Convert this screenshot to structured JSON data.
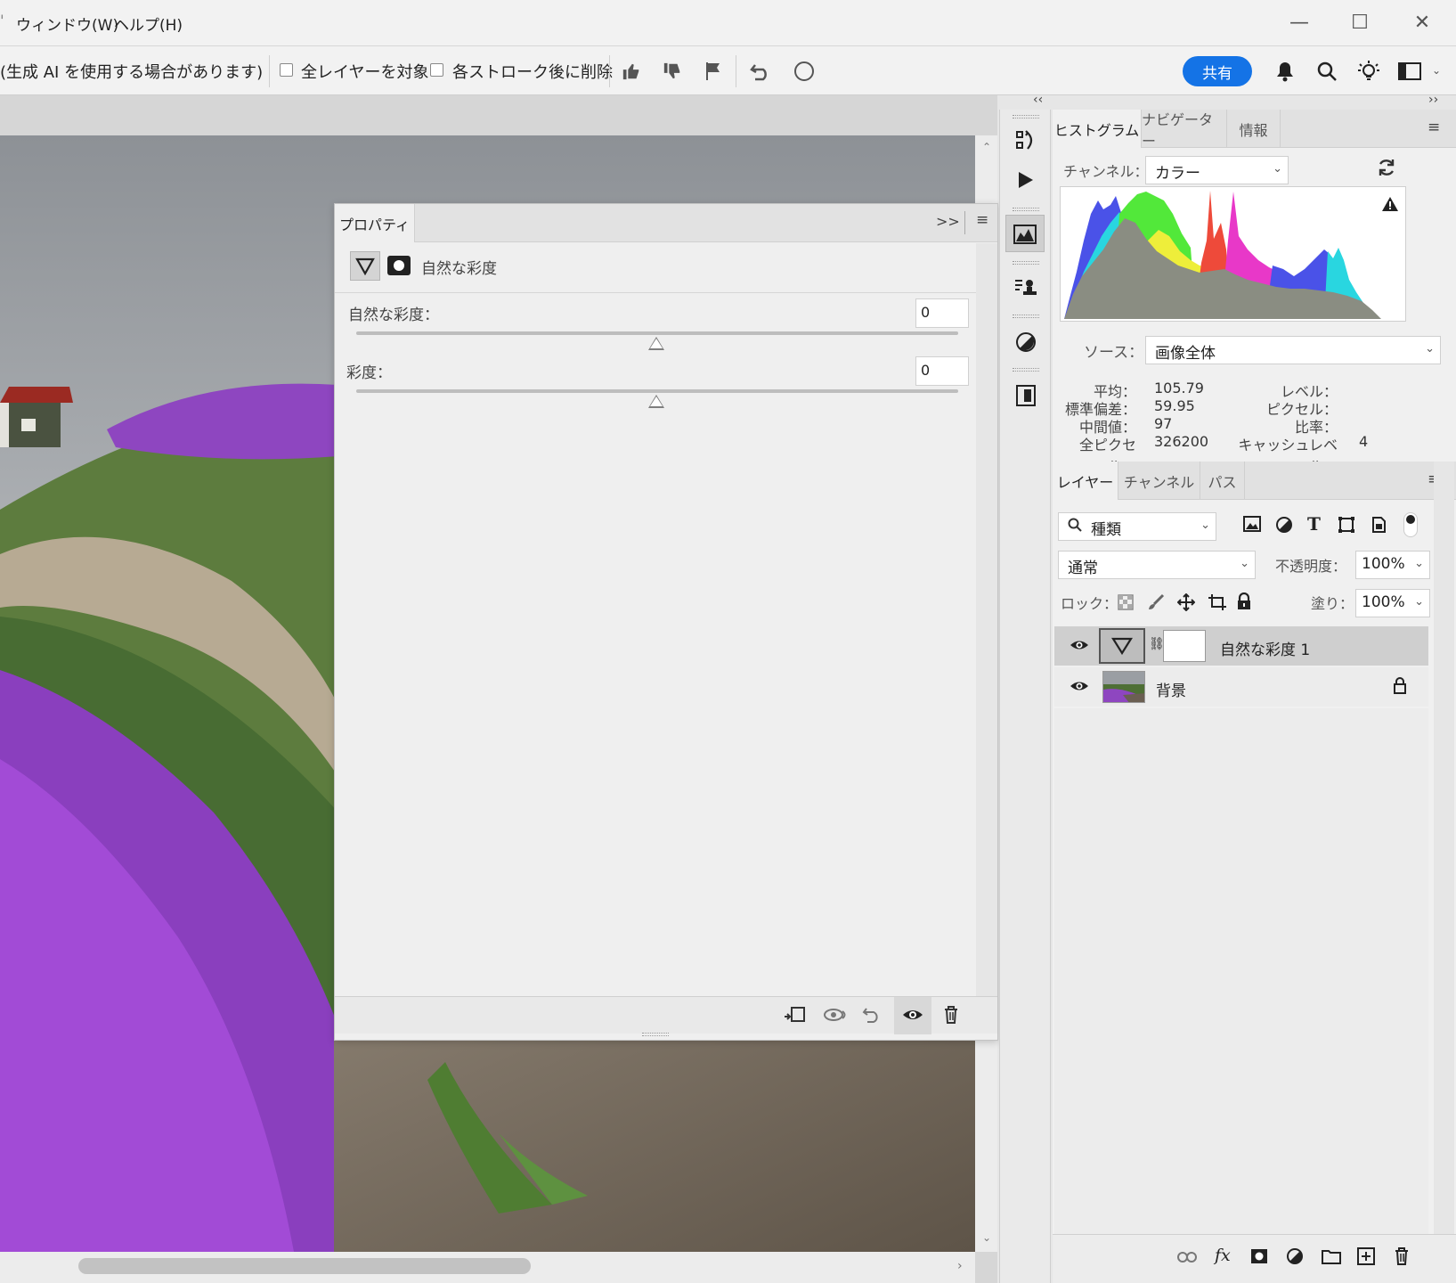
{
  "menubar": {
    "items": [
      "ウィンドウ(W)",
      "ヘルプ(H)"
    ],
    "minimize": "—",
    "maximize": "☐",
    "close": "✕"
  },
  "options": {
    "gen_ai_select": "(生成 AI を使用する場合があります)",
    "sample_all_layers": "全レイヤーを対象",
    "delete_after_stroke": "各ストローク後に削除",
    "share": "共有"
  },
  "properties": {
    "tab": "プロパティ",
    "adjustment_name": "自然な彩度",
    "vibrance_label": "自然な彩度：",
    "vibrance_value": "0",
    "saturation_label": "彩度：",
    "saturation_value": "0"
  },
  "histogram": {
    "tabs": [
      "ヒストグラム",
      "ナビゲーター",
      "情報"
    ],
    "channel_label": "チャンネル：",
    "channel_value": "カラー",
    "source_label": "ソース：",
    "source_value": "画像全体",
    "stats": {
      "mean_label": "平均：",
      "mean": "105.79",
      "stddev_label": "標準偏差：",
      "stddev": "59.95",
      "median_label": "中間値：",
      "median": "97",
      "pixels_label": "全ピクセル：",
      "pixels": "326200",
      "level_label": "レベル：",
      "count_label": "ピクセル：",
      "percent_label": "比率：",
      "cache_label": "キャッシュレベル：",
      "cache": "4"
    }
  },
  "layers": {
    "tabs": [
      "レイヤー",
      "チャンネル",
      "パス"
    ],
    "filter_kind": "種類",
    "blend_mode": "通常",
    "opacity_label": "不透明度：",
    "opacity": "100%",
    "lock_label": "ロック：",
    "fill_label": "塗り：",
    "fill": "100%",
    "items": [
      {
        "name": "自然な彩度 1",
        "selected": true
      },
      {
        "name": "背景",
        "selected": false
      }
    ]
  },
  "colors": {
    "accent": "#1473e6",
    "lavender": "#9b3fd1",
    "grass": "#5b8a3a"
  }
}
